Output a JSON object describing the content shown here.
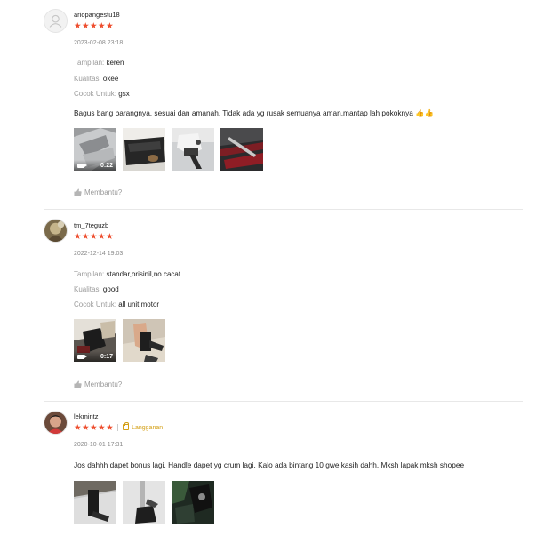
{
  "reviews": [
    {
      "username": "ariopangestu18",
      "stars": "★★★★★",
      "date": "2023-02-08 23:18",
      "attributes": [
        {
          "key": "Tampilan:",
          "value": "keren"
        },
        {
          "key": "Kualitas:",
          "value": "okee"
        },
        {
          "key": "Cocok Untuk:",
          "value": "gsx"
        }
      ],
      "comment": "Bagus bang barangnya, sesuai dan amanah. Tidak ada yg rusak semuanya aman,mantap lah pokoknya 👍👍",
      "video_duration": "0:22",
      "helpful": "Membantu?"
    },
    {
      "username": "tm_7teguzb",
      "stars": "★★★★★",
      "date": "2022-12-14 19:03",
      "attributes": [
        {
          "key": "Tampilan:",
          "value": "standar,orisinil,no cacat"
        },
        {
          "key": "Kualitas:",
          "value": "good"
        },
        {
          "key": "Cocok Untuk:",
          "value": "all unit motor"
        }
      ],
      "video_duration": "0:17",
      "helpful": "Membantu?"
    },
    {
      "username": "lekmintz",
      "stars": "★★★★★",
      "badge": "Langganan",
      "date": "2020-10-01 17:31",
      "comment": "Jos dahhh dapet bonus lagi. Handle dapet yg crum lagi. Kalo ada bintang 10 gwe kasih dahh. Mksh lapak mksh shopee"
    }
  ],
  "colors": {
    "star": "#ee4d2d",
    "badge": "#d4a017",
    "muted": "#9b9b9b"
  },
  "icons": [
    "default-avatar-icon",
    "star-icon",
    "camera-icon",
    "thumbs-up-icon",
    "shop-bag-icon"
  ]
}
